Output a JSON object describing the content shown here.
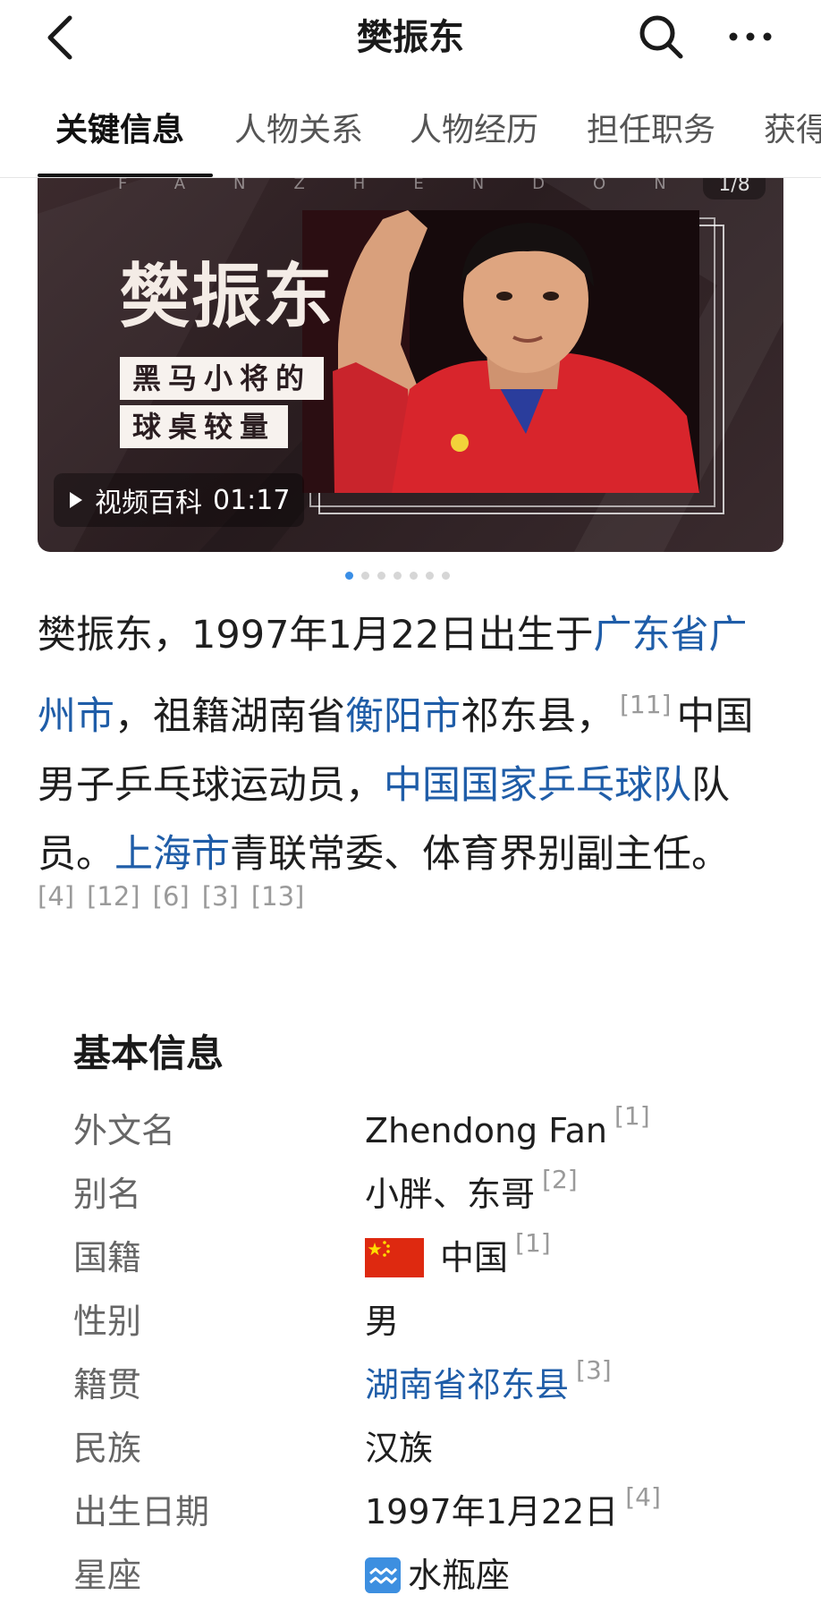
{
  "header": {
    "title": "樊振东",
    "back_icon": "chevron-left-icon",
    "search_icon": "search-icon",
    "more_icon": "more-horizontal-icon"
  },
  "tabs": [
    {
      "label": "关键信息",
      "active": true
    },
    {
      "label": "人物关系",
      "active": false
    },
    {
      "label": "人物经历",
      "active": false
    },
    {
      "label": "担任职务",
      "active": false
    },
    {
      "label": "获得",
      "active": false
    }
  ],
  "hero": {
    "spell": "FANZHENDON",
    "counter": "1/8",
    "name": "樊振东",
    "subtitle_line1": "黑马小将的",
    "subtitle_line2": "球桌较量",
    "video_label": "视频百科",
    "video_duration": "01:17"
  },
  "carousel": {
    "count": 7,
    "active_index": 0,
    "active_color": "#3a8ee6"
  },
  "intro": {
    "p1": "樊振东，1997年1月22日出生于",
    "link1": "广东省广州市",
    "p2": "，祖籍湖南省",
    "link2": "衡阳市",
    "p3": "祁东县，",
    "ref1": "[11]",
    "p4": "中国男子乒乓球运动员，",
    "link3": "中国国家乒乓球队",
    "p5": "队员。",
    "link4": "上海市",
    "p6": "青联常委、体育界别副主任。",
    "refs": [
      "[4]",
      "[12]",
      "[6]",
      "[3]",
      "[13]"
    ]
  },
  "basic_info": {
    "title": "基本信息",
    "rows": [
      {
        "key": "外文名",
        "value": "Zhendong Fan",
        "ref": "[1]"
      },
      {
        "key": "别名",
        "value": "小胖、东哥",
        "ref": "[2]"
      },
      {
        "key": "国籍",
        "value": "中国",
        "ref": "[1]",
        "icon": "china-flag-icon"
      },
      {
        "key": "性别",
        "value": "男",
        "ref": ""
      },
      {
        "key": "籍贯",
        "value": "湖南省祁东县",
        "ref": "[3]",
        "link": true
      },
      {
        "key": "民族",
        "value": "汉族",
        "ref": ""
      },
      {
        "key": "出生日期",
        "value": "1997年1月22日",
        "ref": "[4]"
      },
      {
        "key": "星座",
        "value": "水瓶座",
        "ref": "",
        "icon": "aquarius-icon"
      }
    ]
  },
  "colors": {
    "link": "#1f5da8",
    "hero_bg": "#2a1d20",
    "flag_red": "#de2910",
    "flag_yellow": "#ffde00",
    "aquarius_blue": "#3d8fe0"
  }
}
